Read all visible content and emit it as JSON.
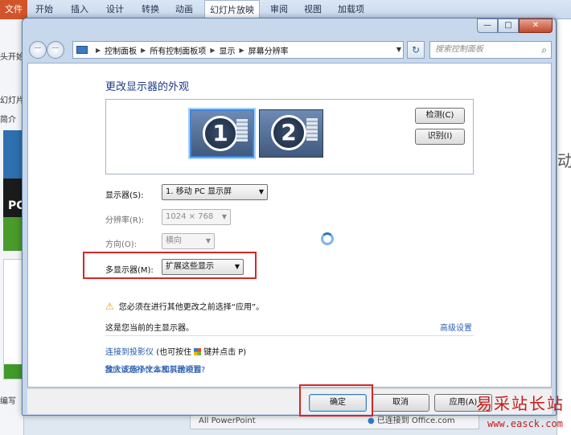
{
  "ppt": {
    "file_tab": "文件",
    "tabs": [
      "开始",
      "插入",
      "设计",
      "转换",
      "动画",
      "幻灯片放映",
      "审阅",
      "视图",
      "加载项"
    ],
    "active_tab": "幻灯片放映",
    "left_labels": [
      "头开始",
      "幻灯片",
      "简介"
    ],
    "thumb_text": "PC",
    "bottom_left_label": "编写",
    "right_char": "动",
    "status_left": "All PowerPoint",
    "status_right": "已连接到 Office.com"
  },
  "window": {
    "caption_buttons": [
      "—",
      "□",
      "✕"
    ],
    "breadcrumbs": [
      "控制面板",
      "所有控制面板项",
      "显示",
      "屏幕分辨率"
    ],
    "search_placeholder": "搜索控制面板"
  },
  "page": {
    "heading": "更改显示器的外观",
    "monitors": [
      "1",
      "2"
    ],
    "detect_button": "检测(C)",
    "identify_button": "识别(I)",
    "display_label": "显示器(S):",
    "display_value": "1. 移动 PC 显示屏",
    "resolution_label": "分辨率(R):",
    "resolution_value": "1024 × 768",
    "orientation_label": "方向(O):",
    "orientation_value": "横向",
    "multi_label": "多显示器(M):",
    "multi_value": "扩展这些显示",
    "warning": "您必须在进行其他更改之前选择“应用”。",
    "primary_text": "这是您当前的主显示器。",
    "advanced_link": "高级设置",
    "link_projector": "连接到投影仪",
    "link_projector_hint_pre": "(也可按住",
    "link_projector_hint_post": "键并点击 P)",
    "link_text_size": "放大或缩小文本和其他项目",
    "link_which": "我应该选择什么显示器设置?"
  },
  "footer": {
    "ok": "确定",
    "cancel": "取消",
    "apply": "应用(A)"
  },
  "watermark": {
    "text": "易采站长站",
    "url": "www.easck.com"
  }
}
